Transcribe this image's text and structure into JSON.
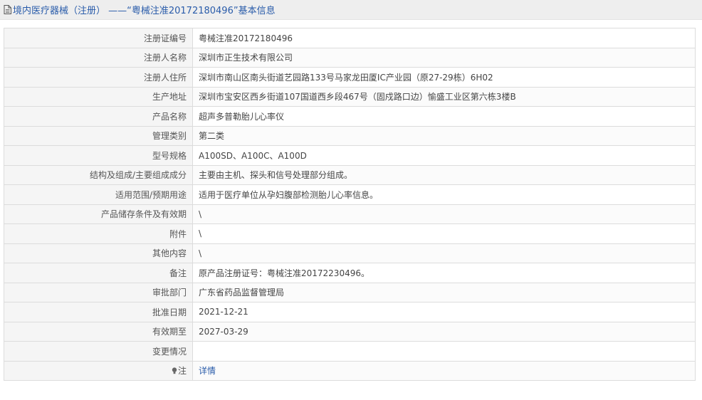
{
  "header": {
    "title": "境内医疗器械（注册） ——“粤械注准20172180496”基本信息"
  },
  "rows": [
    {
      "label": "注册证编号",
      "value": "粤械注准20172180496"
    },
    {
      "label": "注册人名称",
      "value": "深圳市正生技术有限公司"
    },
    {
      "label": "注册人住所",
      "value": "深圳市南山区南头街道艺园路133号马家龙田厦IC产业园（原27-29栋）6H02"
    },
    {
      "label": "生产地址",
      "value": "深圳市宝安区西乡街道107国道西乡段467号（固戍路口边）愉盛工业区第六栋3楼B"
    },
    {
      "label": "产品名称",
      "value": "超声多普勒胎儿心率仪"
    },
    {
      "label": "管理类别",
      "value": "第二类"
    },
    {
      "label": "型号规格",
      "value": "A100SD、A100C、A100D"
    },
    {
      "label": "结构及组成/主要组成成分",
      "value": "主要由主机、探头和信号处理部分组成。"
    },
    {
      "label": "适用范围/预期用途",
      "value": "适用于医疗单位从孕妇腹部检测胎儿心率信息。"
    },
    {
      "label": "产品储存条件及有效期",
      "value": "\\"
    },
    {
      "label": "附件",
      "value": "\\"
    },
    {
      "label": "其他内容",
      "value": "\\"
    },
    {
      "label": "备注",
      "value": "原产品注册证号：粤械注准20172230496。"
    },
    {
      "label": "审批部门",
      "value": "广东省药品监督管理局"
    },
    {
      "label": "批准日期",
      "value": "2021-12-21"
    },
    {
      "label": "有效期至",
      "value": "2027-03-29"
    },
    {
      "label": "变更情况",
      "value": ""
    }
  ],
  "note": {
    "label": "注",
    "link_text": "详情"
  },
  "colors": {
    "title_text": "#2a5caa",
    "title_bg": "#eeeeee",
    "label_bg": "#f5f5f5",
    "border": "#dcdcdc",
    "link": "#2a5caa"
  },
  "icons": {
    "title": "document-icon",
    "note": "lightbulb-icon"
  }
}
